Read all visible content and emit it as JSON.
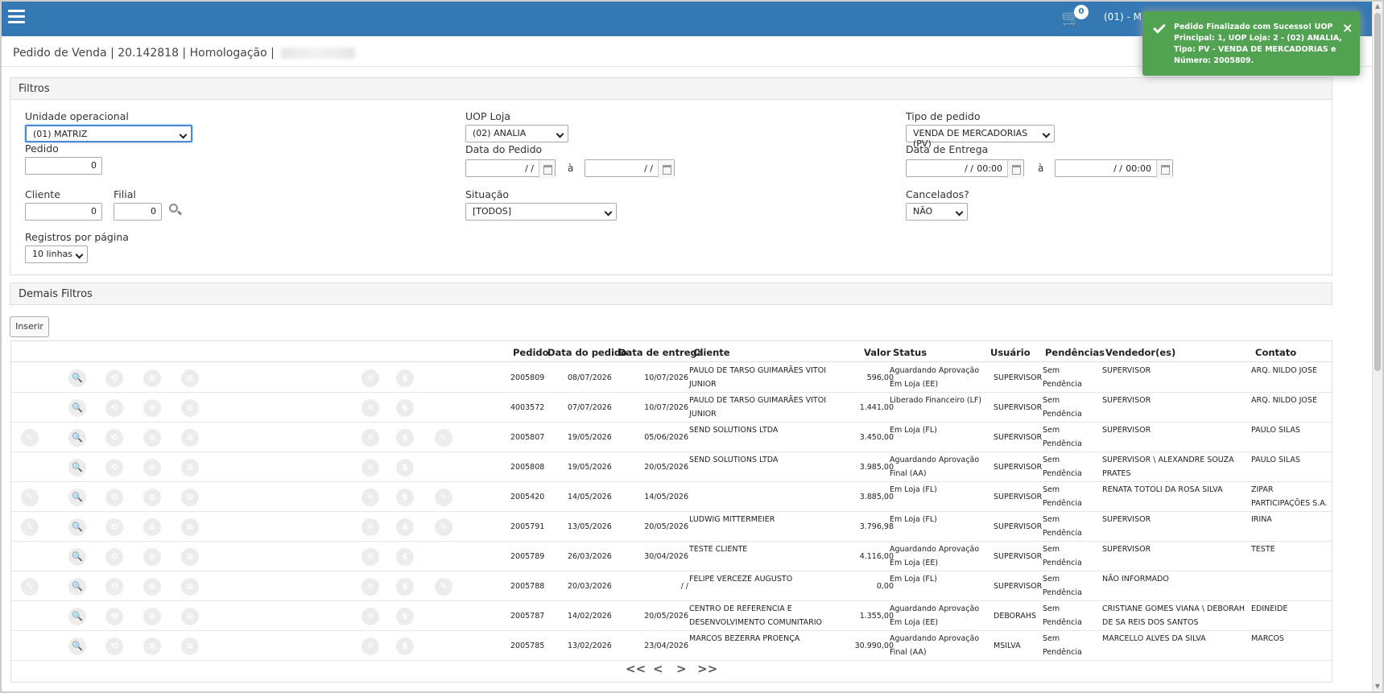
{
  "topbar": {
    "cart_count": "0",
    "uop_text": "(01) - M"
  },
  "breadcrumb": {
    "module": "Pedido de Venda",
    "version": "20.142818",
    "environment": "Homologação"
  },
  "filters": {
    "title": "Filtros",
    "unidade_label": "Unidade operacional",
    "unidade_value": "(01) MATRIZ",
    "uop_loja_label": "UOP Loja",
    "uop_loja_value": "(02) ANALIA",
    "tipo_label": "Tipo de pedido",
    "tipo_value": "VENDA DE MERCADORIAS (PV)",
    "pedido_label": "Pedido",
    "pedido_value": "0",
    "data_pedido_label": "Data do Pedido",
    "data_pedido_from": "/ /",
    "data_pedido_to": "/ /",
    "a_label": "à",
    "data_entrega_label": "Data de Entrega",
    "data_entrega_from": "/ /",
    "data_entrega_from_time": "00:00",
    "data_entrega_to": "/ /",
    "data_entrega_to_time": "00:00",
    "cliente_label": "Cliente",
    "cliente_value": "0",
    "filial_label": "Filial",
    "filial_value": "0",
    "situacao_label": "Situação",
    "situacao_value": "[TODOS]",
    "cancelados_label": "Cancelados?",
    "cancelados_value": "NÃO",
    "registros_label": "Registros por página",
    "registros_value": "10 linhas"
  },
  "demais_filtros": {
    "title": "Demais Filtros"
  },
  "actions": {
    "inserir_label": "Inserir"
  },
  "table": {
    "headers": {
      "pedido": "Pedido",
      "data_pedido": "Data do pedido",
      "data_entrega": "Data de entrega",
      "cliente": "Cliente",
      "valor": "Valor",
      "status": "Status",
      "usuario": "Usuário",
      "pendencias": "Pendências",
      "vendedor": "Vendedor(es)",
      "contato": "Contato"
    },
    "rows": [
      {
        "pedido": "2005809",
        "data_pedido": "08/07/2026",
        "data_entrega": "10/07/2026",
        "cliente": "PAULO DE TARSO GUIMARÃES VITOI JUNIOR",
        "valor": "596,00",
        "status": "Aguardando Aprovação Em Loja (EE)",
        "usuario": "SUPERVISOR",
        "pendencias": "Sem Pendência",
        "vendedor": "SUPERVISOR",
        "contato": "ARQ. NILDO JOSE",
        "edit": false,
        "tag": false
      },
      {
        "pedido": "4003572",
        "data_pedido": "07/07/2026",
        "data_entrega": "10/07/2026",
        "cliente": "PAULO DE TARSO GUIMARÃES VITOI JUNIOR",
        "valor": "1.441,00",
        "status": "Liberado Financeiro (LF)",
        "usuario": "SUPERVISOR",
        "pendencias": "Sem Pendência",
        "vendedor": "SUPERVISOR",
        "contato": "ARQ. NILDO JOSE",
        "edit": false,
        "tag": false
      },
      {
        "pedido": "2005807",
        "data_pedido": "19/05/2026",
        "data_entrega": "05/06/2026",
        "cliente": "SEND SOLUTIONS LTDA",
        "valor": "3.450,00",
        "status": "Em Loja (FL)",
        "usuario": "SUPERVISOR",
        "pendencias": "Sem Pendência",
        "vendedor": "SUPERVISOR",
        "contato": "PAULO SILAS",
        "edit": true,
        "tag": true
      },
      {
        "pedido": "2005808",
        "data_pedido": "19/05/2026",
        "data_entrega": "20/05/2026",
        "cliente": "SEND SOLUTIONS LTDA",
        "valor": "3.985,00",
        "status": "Aguardando Aprovação Final (AA)",
        "usuario": "SUPERVISOR",
        "pendencias": "Sem Pendência",
        "vendedor": "SUPERVISOR \\ ALEXANDRE SOUZA PRATES",
        "contato": "PAULO SILAS",
        "edit": false,
        "tag": false
      },
      {
        "pedido": "2005420",
        "data_pedido": "14/05/2026",
        "data_entrega": "14/05/2026",
        "cliente": "",
        "valor": "3.885,00",
        "status": "Em Loja (FL)",
        "usuario": "SUPERVISOR",
        "pendencias": "Sem Pendência",
        "vendedor": "RENATA TOTOLI DA ROSA SILVA",
        "contato": "ZIPAR PARTICIPAÇÕES S.A.",
        "edit": true,
        "tag": true
      },
      {
        "pedido": "2005791",
        "data_pedido": "13/05/2026",
        "data_entrega": "20/05/2026",
        "cliente": "LUDWIG MITTERMEIER",
        "valor": "3.796,98",
        "status": "Em Loja (FL)",
        "usuario": "SUPERVISOR",
        "pendencias": "Sem Pendência",
        "vendedor": "SUPERVISOR",
        "contato": "IRINA",
        "edit": true,
        "tag": true
      },
      {
        "pedido": "2005789",
        "data_pedido": "26/03/2026",
        "data_entrega": "30/04/2026",
        "cliente": "TESTE CLIENTE",
        "valor": "4.116,00",
        "status": "Aguardando Aprovação Em Loja (EE)",
        "usuario": "SUPERVISOR",
        "pendencias": "Sem Pendência",
        "vendedor": "SUPERVISOR",
        "contato": "TESTE",
        "edit": false,
        "tag": false
      },
      {
        "pedido": "2005788",
        "data_pedido": "20/03/2026",
        "data_entrega": "/ /",
        "cliente": "FELIPE VERCEZE AUGUSTO",
        "valor": "0,00",
        "status": "Em Loja (FL)",
        "usuario": "SUPERVISOR",
        "pendencias": "Sem Pendência",
        "vendedor": "NÃO INFORMADO",
        "contato": "",
        "edit": true,
        "tag": true
      },
      {
        "pedido": "2005787",
        "data_pedido": "14/02/2026",
        "data_entrega": "20/05/2026",
        "cliente": "CENTRO DE REFERENCIA E DESENVOLVIMENTO COMUNITARIO",
        "valor": "1.355,00",
        "status": "Aguardando Aprovação Em Loja (EE)",
        "usuario": "DEBORAHS",
        "pendencias": "Sem Pendência",
        "vendedor": "CRISTIANE GOMES VIANA \\ DEBORAH DE SA REIS DOS SANTOS",
        "contato": "EDINEIDE",
        "edit": false,
        "tag": false
      },
      {
        "pedido": "2005785",
        "data_pedido": "13/02/2026",
        "data_entrega": "23/04/2026",
        "cliente": "MARCOS BEZERRA PROENÇA",
        "valor": "30.990,00",
        "status": "Aguardando Aprovação Final (AA)",
        "usuario": "MSILVA",
        "pendencias": "Sem Pendência",
        "vendedor": "MARCELLO ALVES DA SILVA",
        "contato": "MARCOS",
        "edit": false,
        "tag": false
      }
    ]
  },
  "pager": {
    "first": "<<",
    "prev": "<",
    "next": ">",
    "last": ">>"
  },
  "toast": {
    "message": "Pedido Finalizado com Sucesso! UOP Principal: 1, UOP Loja: 2 - (02) ANALIA, Tipo: PV - VENDA DE MERCADORIAS e Número: 2005809.",
    "close": "×"
  },
  "colors": {
    "topbar": "#3478b4",
    "toast": "#51a351"
  }
}
